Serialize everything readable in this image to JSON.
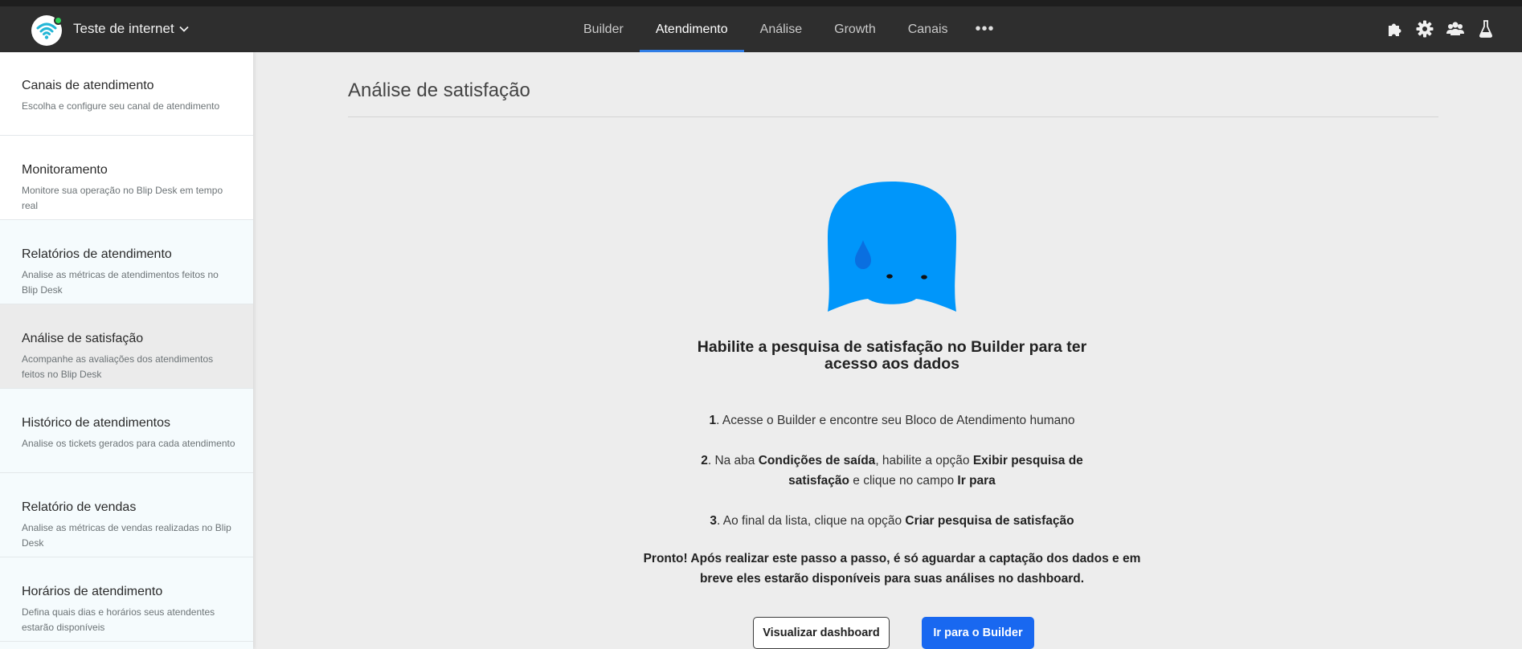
{
  "header": {
    "bot_name": "Teste de internet",
    "tabs": [
      {
        "label": "Builder",
        "active": false
      },
      {
        "label": "Atendimento",
        "active": true
      },
      {
        "label": "Análise",
        "active": false
      },
      {
        "label": "Growth",
        "active": false
      },
      {
        "label": "Canais",
        "active": false
      }
    ],
    "more_label": "•••",
    "right_icons": [
      "puzzle-icon",
      "gear-icon",
      "team-icon",
      "flask-icon"
    ],
    "status_color": "#2ed158",
    "accent_color": "#2f7de6"
  },
  "sidebar": {
    "items": [
      {
        "title": "Canais de atendimento",
        "desc": "Escolha e configure seu canal de atendimento"
      },
      {
        "title": "Monitoramento",
        "desc": "Monitore sua operação no Blip Desk em tempo real"
      },
      {
        "title": "Relatórios de atendimento",
        "desc": "Analise as métricas de atendimentos feitos no Blip Desk"
      },
      {
        "title": "Análise de satisfação",
        "desc": "Acompanhe as avaliações dos atendimentos feitos no Blip Desk",
        "active": true
      },
      {
        "title": "Histórico de atendimentos",
        "desc": "Analise os tickets gerados para cada atendimento"
      },
      {
        "title": "Relatório de vendas",
        "desc": "Analise as métricas de vendas realizadas no Blip Desk"
      },
      {
        "title": "Horários de atendimento",
        "desc": "Defina quais dias e horários seus atendentes estarão disponíveis"
      }
    ]
  },
  "main": {
    "page_title": "Análise de satisfação",
    "headline": "Habilite a pesquisa de satisfação no Builder para ter acesso aos dados",
    "steps": [
      {
        "num": "1",
        "parts": [
          {
            "t": ". Acesse o Builder e encontre seu Bloco de Atendimento humano",
            "b": false
          }
        ]
      },
      {
        "num": "2",
        "parts": [
          {
            "t": ". Na aba ",
            "b": false
          },
          {
            "t": "Condições de saída",
            "b": true
          },
          {
            "t": ", habilite a opção ",
            "b": false
          },
          {
            "t": "Exibir pesquisa de satisfação",
            "b": true
          },
          {
            "t": " e clique no campo ",
            "b": false
          },
          {
            "t": "Ir para",
            "b": true
          }
        ]
      },
      {
        "num": "3",
        "parts": [
          {
            "t": ". Ao final da lista, clique na opção ",
            "b": false
          },
          {
            "t": "Criar pesquisa de satisfação",
            "b": true
          }
        ]
      }
    ],
    "final_note": "Pronto! Após realizar este passo a passo, é só aguardar a captação dos dados e em breve eles estarão disponíveis para suas análises no dashboard.",
    "btn_dashboard": "Visualizar dashboard",
    "btn_builder": "Ir para o Builder",
    "mascot_icon": "sad-blip-mascot-icon",
    "mascot_color": "#0096fa",
    "primary_color": "#1968f0"
  }
}
